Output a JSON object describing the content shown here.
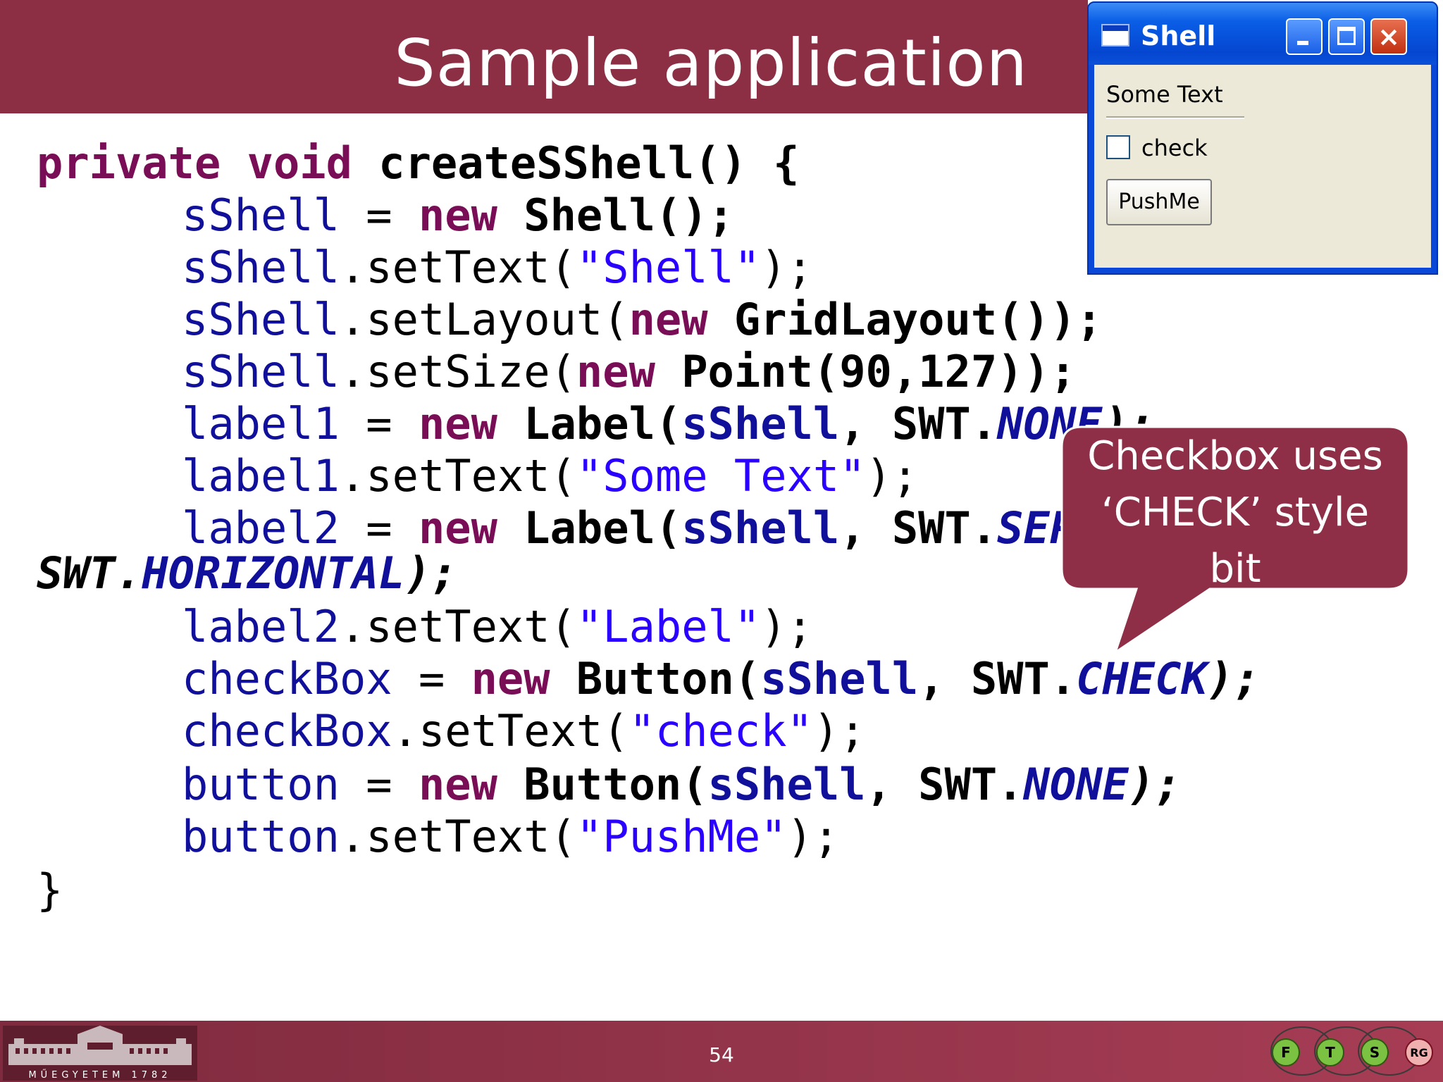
{
  "slide": {
    "title": "Sample application",
    "page_number": "54",
    "university_logo_text": "MŰEGYETEM 1782",
    "research_group_logos": [
      "F",
      "T",
      "S",
      "RG"
    ]
  },
  "code": {
    "line1": {
      "kw1": "private void",
      "rest": " createSShell() {"
    },
    "line2": {
      "field": "sShell",
      "op": " = ",
      "kw": "new",
      "rest": " Shell();"
    },
    "line3": {
      "field": "sShell",
      "method": ".setText(",
      "str": "\"Shell\"",
      "end": ");"
    },
    "line4": {
      "field": "sShell",
      "method": ".setLayout(",
      "kw": "new",
      "rest": " GridLayout());"
    },
    "line5": {
      "field": "sShell",
      "method": ".setSize(",
      "kw": "new",
      "rest": " Point(90,127));"
    },
    "line6": {
      "field": "label1",
      "op": " = ",
      "kw": "new",
      "cls": " Label(",
      "arg": "sShell",
      "comma": ", SWT.",
      "const": "NONE",
      "end": ");"
    },
    "line7": {
      "field": "label1",
      "method": ".setText(",
      "str": "\"Some Text\"",
      "end": ");"
    },
    "line8": {
      "field": "label2",
      "op": " = ",
      "kw": "new",
      "cls": " Label(",
      "arg": "sShell",
      "comma": ", SWT.",
      "const": "SEPARATOR",
      "end": " |"
    },
    "line9": {
      "swt": "SWT.",
      "const": "HORIZONTAL",
      "end": ");"
    },
    "line10": {
      "field": "label2",
      "method": ".setText(",
      "str": "\"Label\"",
      "end": ");"
    },
    "line11": {
      "field": "checkBox",
      "op": " = ",
      "kw": "new",
      "cls": " Button(",
      "arg": "sShell",
      "comma": ", SWT.",
      "const": "CHECK",
      "end": ");"
    },
    "line12": {
      "field": "checkBox",
      "method": ".setText(",
      "str": "\"check\"",
      "end": ");"
    },
    "line13": {
      "field": "button",
      "op": " = ",
      "kw": "new",
      "cls": " Button(",
      "arg": "sShell",
      "comma": ", SWT.",
      "const": "NONE",
      "end": ");"
    },
    "line14": {
      "field": "button",
      "method": ".setText(",
      "str": "\"PushMe\"",
      "end": ");"
    },
    "line15": {
      "brace": "}"
    }
  },
  "shell_window": {
    "title": "Shell",
    "label_text": "Some Text",
    "checkbox_label": "check",
    "checkbox_checked": false,
    "button_label": "PushMe",
    "controls": {
      "minimize": "minimize-icon",
      "maximize": "maximize-icon",
      "close": "×"
    }
  },
  "callout": {
    "lines": [
      "Checkbox  uses",
      "‘CHECK’ style",
      "bit"
    ]
  },
  "colors": {
    "brand": "#8c2f45",
    "keyword": "#7a0e56",
    "field": "#10109a",
    "string": "#2a00ff",
    "window_title": "#0a48d8",
    "window_body": "#ece9d8"
  }
}
